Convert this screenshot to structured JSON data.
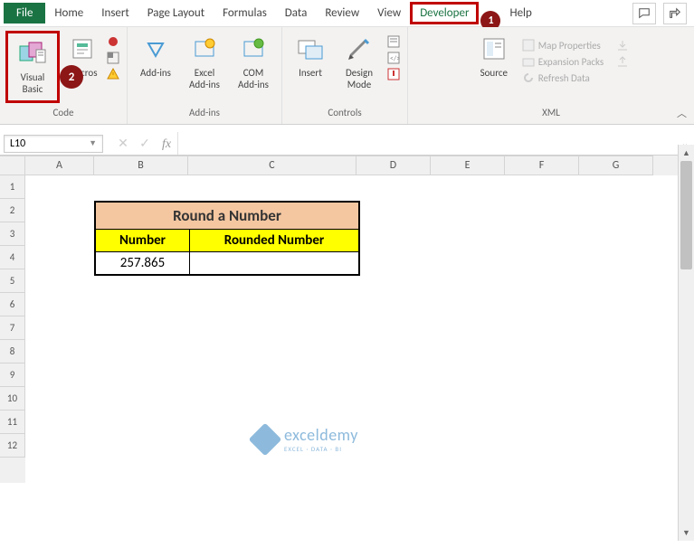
{
  "tabs": {
    "file": "File",
    "home": "Home",
    "insert": "Insert",
    "pagelayout": "Page Layout",
    "formulas": "Formulas",
    "data": "Data",
    "review": "Review",
    "view": "View",
    "developer": "Developer",
    "help": "Help"
  },
  "callouts": {
    "c1": "1",
    "c2": "2"
  },
  "ribbon": {
    "visualbasic": "Visual Basic",
    "macros": "Macros",
    "addins": "Add-ins",
    "exceladdins": "Excel Add-ins",
    "comaddins": "COM Add-ins",
    "insert": "Insert",
    "designmode": "Design Mode",
    "source": "Source",
    "mapprops": "Map Properties",
    "expansion": "Expansion Packs",
    "refresh": "Refresh Data",
    "g_code": "Code",
    "g_addins": "Add-ins",
    "g_controls": "Controls",
    "g_xml": "XML"
  },
  "namebox": "L10",
  "fx": "fx",
  "cols": {
    "A": "A",
    "B": "B",
    "C": "C",
    "D": "D",
    "E": "E",
    "F": "F",
    "G": "G"
  },
  "colw": {
    "A": 76,
    "B": 104,
    "C": 186,
    "D": 82,
    "E": 82,
    "F": 82,
    "G": 82
  },
  "rows": [
    "1",
    "2",
    "3",
    "4",
    "5",
    "6",
    "7",
    "8",
    "9",
    "10",
    "11",
    "12"
  ],
  "table": {
    "title": "Round a Number",
    "h1": "Number",
    "h2": "Rounded Number",
    "v1": "257.865",
    "v2": ""
  },
  "watermark": {
    "name": "exceldemy",
    "sub": "EXCEL · DATA · BI"
  }
}
